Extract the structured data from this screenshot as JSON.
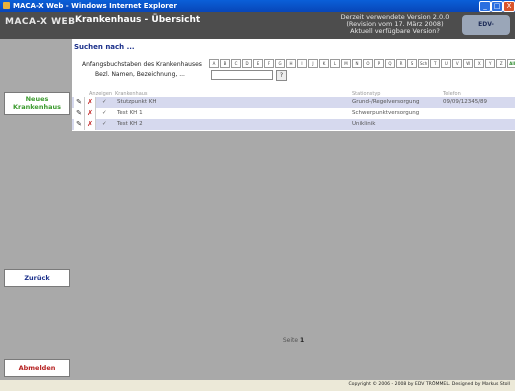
{
  "window": {
    "title": "MACA-X Web - Windows Internet Explorer",
    "minimize": "_",
    "maximize": "□",
    "close": "X"
  },
  "header": {
    "logo": "MACA-X WEB",
    "page_title": "Krankenhaus - Übersicht",
    "version_line1": "Derzeit verwendete Version 2.0.0",
    "version_line2": "(Revision vom 17. März 2008)",
    "version_line3": "Aktuell verfügbare Version?",
    "brand": "EDV-TRÖMMEL"
  },
  "sidebar": {
    "new_line1": "Neues",
    "new_line2": "Krankenhaus",
    "back": "Zurück",
    "logout": "Abmelden"
  },
  "search": {
    "title": "Suchen nach ...",
    "alpha_label": "Anfangsbuchstaben des Krankenhauses",
    "letters": [
      "A",
      "B",
      "C",
      "D",
      "E",
      "F",
      "G",
      "H",
      "I",
      "J",
      "K",
      "L",
      "M",
      "N",
      "O",
      "P",
      "Q",
      "R",
      "S",
      "Sch",
      "T",
      "U",
      "V",
      "W",
      "X",
      "Y",
      "Z",
      "Alle"
    ],
    "name_label": "Bezl. Namen, Bezeichnung, ...",
    "name_value": "",
    "go": "?"
  },
  "table": {
    "headers": {
      "anzeigen": "Anzeigen",
      "krankenhaus": "Krankenhaus",
      "stationstyp": "Stationstyp",
      "telefon": "Telefon"
    },
    "rows": [
      {
        "check": "✓",
        "name": "Stutzpunkt KH",
        "typ": "Grund-/Regelversorgung",
        "telefon": "09/09/12345/89"
      },
      {
        "check": "✓",
        "name": "Test KH 1",
        "typ": "Schwerpunktversorgung",
        "telefon": ""
      },
      {
        "check": "✓",
        "name": "Test KH 2",
        "typ": "Uniklinik",
        "telefon": ""
      }
    ]
  },
  "pagination": {
    "label": "Seite",
    "page": "1"
  },
  "footer": {
    "copyright": "Copyright © 2006 - 2008 by EDV TRÖMMEL. Designed by Markus Stoll"
  }
}
